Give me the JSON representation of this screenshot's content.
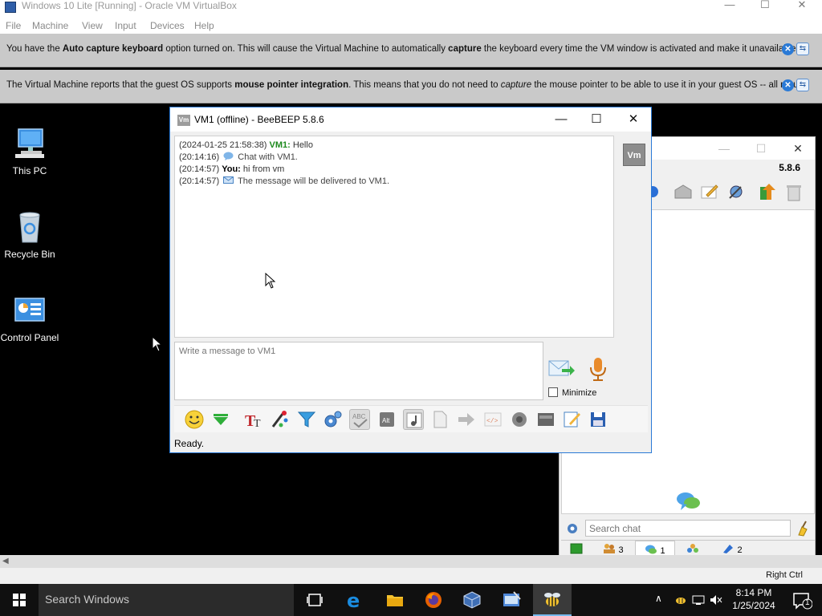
{
  "host": {
    "title": "Windows 10 Lite [Running] - Oracle VM VirtualBox",
    "controls": {
      "minimize": "—",
      "maximize": "☐",
      "close": "✕"
    },
    "menu": [
      "File",
      "Machine",
      "View",
      "Input",
      "Devices",
      "Help"
    ],
    "status_hostkey": "Right Ctrl"
  },
  "notices": [
    {
      "before": "You have the ",
      "bold1": "Auto capture keyboard",
      "middle": " option turned on. This will cause the Virtual Machine to automatically ",
      "bold2": "capture",
      "after": " the keyboard every time the VM window is activated and make it unavailable to"
    },
    {
      "before": "The Virtual Machine reports that the guest OS supports ",
      "bold1": "mouse pointer integration",
      "middle": ". This means that you do not need to ",
      "italic": "capture",
      "after": " the mouse pointer to be able to use it in your guest OS -- all mouse"
    }
  ],
  "desktop": {
    "icons": [
      {
        "label": "This PC",
        "icon": "computer-icon"
      },
      {
        "label": "Recycle Bin",
        "icon": "recycle-bin-icon"
      },
      {
        "label": "Control Panel",
        "icon": "control-panel-icon"
      }
    ]
  },
  "chat_window": {
    "title": "VM1 (offline) - BeeBEEP 5.8.6",
    "app_icon_text": "Vm",
    "avatar_text": "Vm",
    "messages": [
      {
        "ts": "(2024-01-25 21:58:38)",
        "name": "VM1:",
        "text": " Hello",
        "type": "remote"
      },
      {
        "ts": "(20:14:16)",
        "text": "Chat with VM1.",
        "type": "system",
        "icon": "chat-bubble-icon"
      },
      {
        "ts": "(20:14:57)",
        "name": "You:",
        "text": " hi from vm",
        "type": "self"
      },
      {
        "ts": "(20:14:57)",
        "text": "The message will be delivered to VM1.",
        "type": "system",
        "icon": "envelope-icon"
      }
    ],
    "input_placeholder": "Write a message to VM1",
    "minimize_label": "Minimize",
    "status": "Ready.",
    "toolbar_icons": [
      "emoticon-icon",
      "green-arrow-icon",
      "font-icon",
      "color-picker-icon",
      "filter-icon",
      "settings-icon",
      "spellcheck-icon",
      "alt-icon",
      "music-note-icon",
      "file-icon",
      "forward-icon",
      "code-icon",
      "record-icon",
      "screenshot-icon",
      "note-edit-icon",
      "save-icon"
    ]
  },
  "side_window": {
    "version": "5.8.6",
    "search_placeholder": "Search chat",
    "tabs": [
      {
        "icon": "home-icon",
        "count": ""
      },
      {
        "icon": "users-icon",
        "count": "3"
      },
      {
        "icon": "chats-icon",
        "count": "1"
      },
      {
        "icon": "groups-icon",
        "count": ""
      },
      {
        "icon": "files-icon",
        "count": "2"
      }
    ]
  },
  "taskbar": {
    "search_placeholder": "Search Windows",
    "time": "8:14 PM",
    "date": "1/25/2024",
    "notification_count": "1"
  }
}
